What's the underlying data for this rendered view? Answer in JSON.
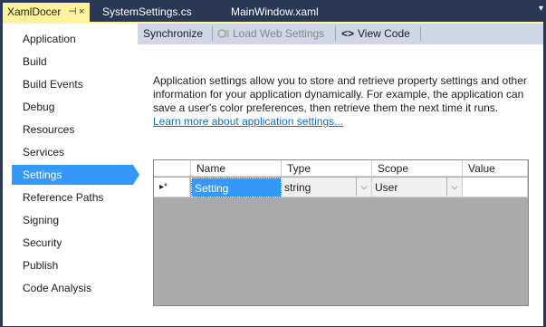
{
  "tabs": [
    {
      "label": "XamlDocer",
      "active": true,
      "pin": "⊣",
      "close": "×"
    },
    {
      "label": "SystemSettings.cs",
      "active": false
    },
    {
      "label": "MainWindow.xaml",
      "active": false
    }
  ],
  "tab_dropdown": "▾",
  "sidebar": {
    "items": [
      {
        "label": "Application"
      },
      {
        "label": "Build"
      },
      {
        "label": "Build Events"
      },
      {
        "label": "Debug"
      },
      {
        "label": "Resources"
      },
      {
        "label": "Services"
      },
      {
        "label": "Settings",
        "active": true
      },
      {
        "label": "Reference Paths"
      },
      {
        "label": "Signing"
      },
      {
        "label": "Security"
      },
      {
        "label": "Publish"
      },
      {
        "label": "Code Analysis"
      }
    ]
  },
  "toolbar": {
    "synchronize": "Synchronize",
    "load_web_settings": "Load Web Settings",
    "view_code": "View Code",
    "view_code_icon": "<>"
  },
  "description": {
    "text": "Application settings allow you to store and retrieve property settings and other information for your application dynamically. For example, the application can save a user's color preferences, then retrieve them the next time it runs.",
    "link": "Learn more about application settings..."
  },
  "grid": {
    "columns": [
      "Name",
      "Type",
      "Scope",
      "Value"
    ],
    "row_marker": "▸*",
    "rows": [
      {
        "name": "Setting",
        "type": "string",
        "scope": "User",
        "value": ""
      }
    ],
    "combo_arrow": "⌵"
  },
  "colors": {
    "accent": "#3399ff",
    "active_tab": "#fff29d",
    "chrome": "#293955",
    "toolbar": "#cfd6e5",
    "link": "#0e70c0"
  }
}
